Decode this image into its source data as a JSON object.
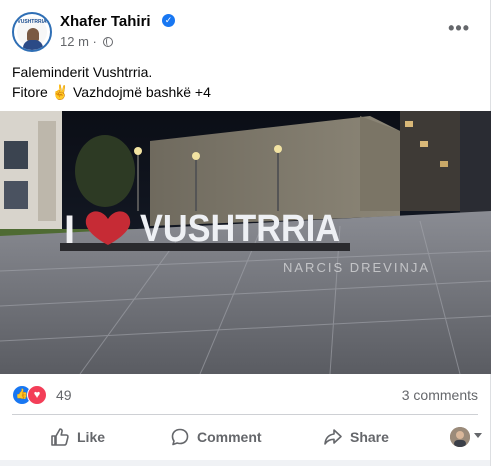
{
  "post": {
    "author": "Xhafer Tahiri",
    "avatar_text": "VUSHTRRIA",
    "time": "12 m",
    "separator": "·",
    "more_label": "•••",
    "text_line1": "Faleminderit Vushtrria.",
    "text_line2": "Fitore ✌️ Vazhdojmë bashkë +4"
  },
  "photo": {
    "sign_text": "VUSHTRRIA",
    "sign_letter_i": "I",
    "watermark": "NARCIS DREVINJA"
  },
  "stats": {
    "reaction_count": "49",
    "comments_label": "3 comments"
  },
  "actions": {
    "like_label": "Like",
    "comment_label": "Comment",
    "share_label": "Share"
  },
  "colors": {
    "accent": "#1877f2",
    "love": "#f33e58",
    "muted_text": "#65676b"
  },
  "icons": [
    "verified-icon",
    "globe-icon",
    "more-options-icon",
    "like-reaction-icon",
    "love-reaction-icon",
    "thumbs-up-icon",
    "comment-bubble-icon",
    "share-arrow-icon",
    "audience-avatar-icon",
    "chevron-down-icon"
  ]
}
